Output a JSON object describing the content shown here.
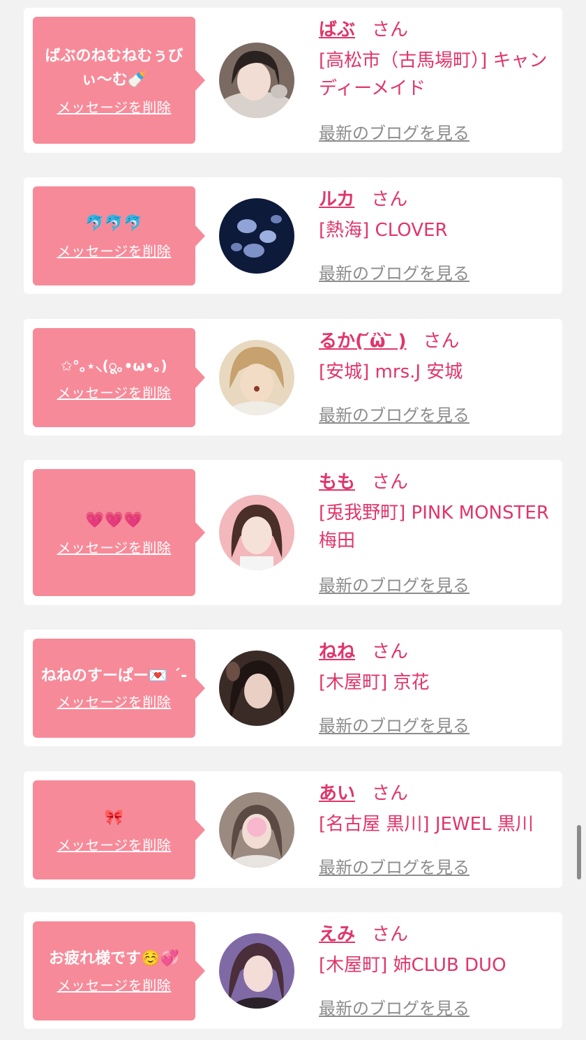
{
  "delete_label": "メッセージを削除",
  "san_label": "さん",
  "blog_label": "最新のブログを見る",
  "colors": {
    "bubble": "#f78a99",
    "accent": "#e0356a",
    "link_gray": "#8c8c8c"
  },
  "cards": [
    {
      "message": "ばぶのねむねむぅびぃ〜む🍼",
      "name": "ばぶ",
      "shop": "[高松市（古馬場町）] キャンディーメイド"
    },
    {
      "message": "🐬🐬🐬",
      "name": "ルカ",
      "shop": "[熱海] CLOVER"
    },
    {
      "message": "✩°｡⋆⸜(ू｡•ω•｡)",
      "name": "るか(   ᷄ὢ ᷅   )",
      "shop": "[安城] mrs.J 安城"
    },
    {
      "message": "💗💗💗",
      "name": "もも",
      "shop": "[兎我野町] PINK MONSTER梅田"
    },
    {
      "message": "ねねのすーぱー💌 ´-",
      "name": "ねね",
      "shop": "[木屋町] 京花"
    },
    {
      "message": "🎀",
      "name": "あい",
      "shop": "[名古屋 黒川] JEWEL 黒川"
    },
    {
      "message": "お疲れ様です☺️💞",
      "name": "えみ",
      "shop": "[木屋町] 姉CLUB DUO"
    }
  ]
}
